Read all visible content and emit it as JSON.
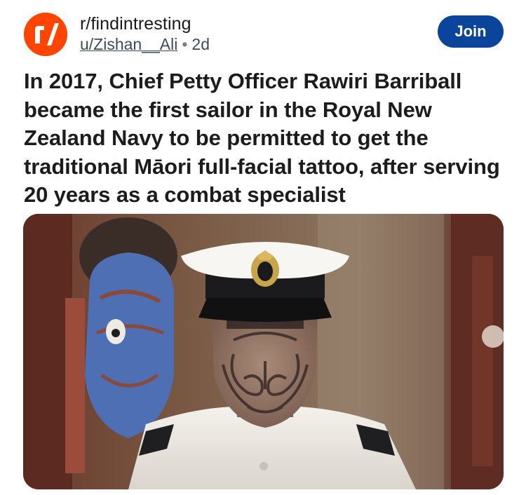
{
  "post": {
    "subreddit": "r/findintresting",
    "author": "u/Zishan__Ali",
    "separator": "•",
    "age": "2d",
    "join_label": "Join",
    "title": "In 2017, Chief Petty Officer Rawiri Barriball became the first sailor in the Royal New Zealand Navy to be permitted to get the traditional Māori full-facial tattoo, after serving 20 years as a combat specialist",
    "image": {
      "icon": "photo-sailor-moko"
    }
  },
  "colors": {
    "brand_orange": "#ff4500",
    "join_blue": "#0a449b",
    "title_text": "#1c1c1c",
    "meta_text": "#3e4a55"
  }
}
